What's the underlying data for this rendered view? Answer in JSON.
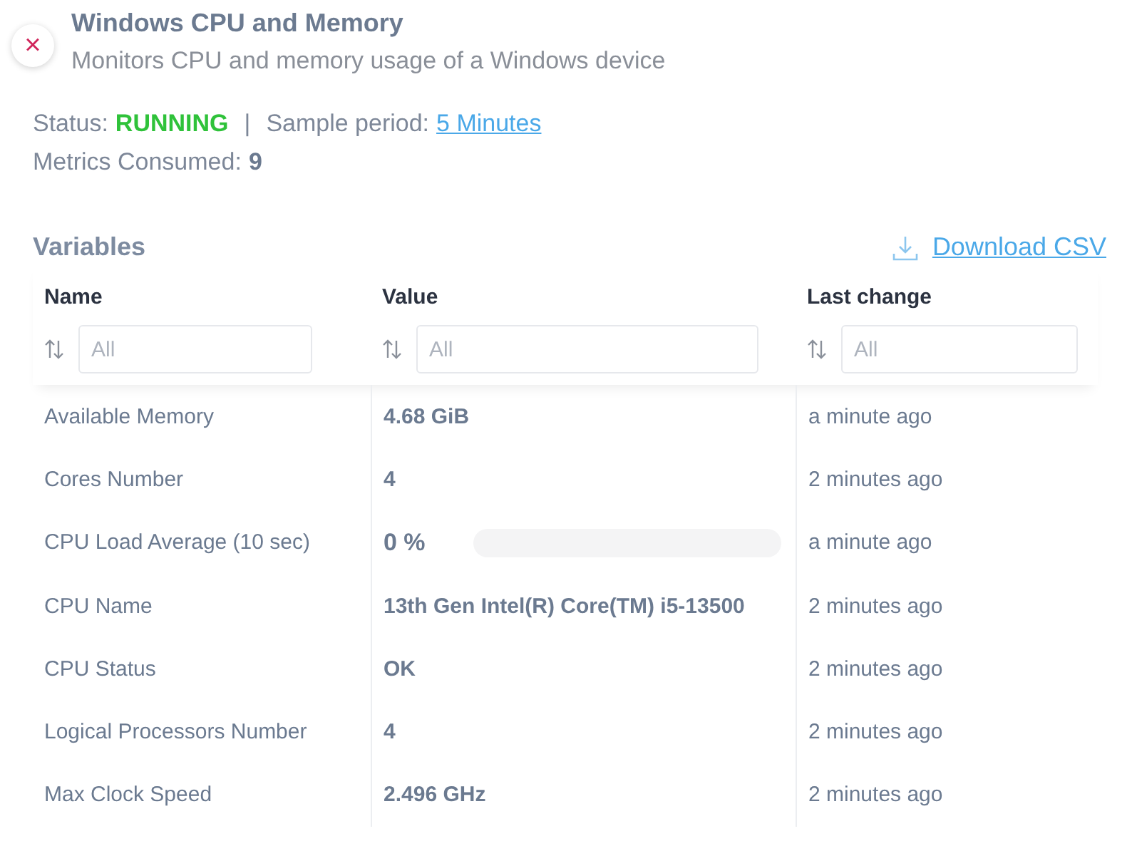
{
  "header": {
    "close_icon": "×",
    "title": "Windows CPU and Memory",
    "subtitle": "Monitors CPU and memory usage of a Windows device"
  },
  "status": {
    "label": "Status:",
    "value": "RUNNING",
    "separator": "|",
    "period_label": "Sample period:",
    "period_link": "5 Minutes",
    "metrics_label": "Metrics Consumed:",
    "metrics_value": "9"
  },
  "variables": {
    "title": "Variables",
    "download": "Download CSV",
    "columns": [
      {
        "label": "Name",
        "placeholder": "All"
      },
      {
        "label": "Value",
        "placeholder": "All"
      },
      {
        "label": "Last change",
        "placeholder": "All"
      }
    ],
    "rows": [
      {
        "kind": "text",
        "name": "Available Memory",
        "value": "4.68 GiB",
        "last_change": "a minute ago"
      },
      {
        "kind": "text",
        "name": "Cores Number",
        "value": "4",
        "last_change": "2 minutes ago"
      },
      {
        "kind": "gauge",
        "name": "CPU Load Average (10 sec)",
        "value": "0 %",
        "last_change": "a minute ago"
      },
      {
        "kind": "text",
        "name": "CPU Name",
        "value": "13th Gen Intel(R) Core(TM) i5-13500",
        "last_change": "2 minutes ago"
      },
      {
        "kind": "text",
        "name": "CPU Status",
        "value": "OK",
        "last_change": "2 minutes ago"
      },
      {
        "kind": "text",
        "name": "Logical Processors Number",
        "value": "4",
        "last_change": "2 minutes ago"
      },
      {
        "kind": "text",
        "name": "Max Clock Speed",
        "value": "2.496 GHz",
        "last_change": "2 minutes ago"
      }
    ]
  }
}
